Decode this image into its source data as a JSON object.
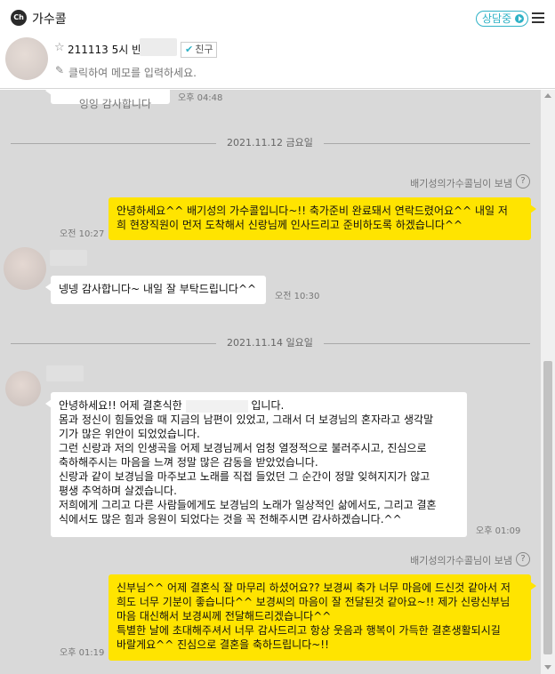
{
  "header": {
    "logo_text": "Ch",
    "title": "가수콜",
    "status_label": "상담중",
    "menu_icon": "hamburger-menu-icon"
  },
  "profile": {
    "name": "211113 5시 반포",
    "friend_badge": "친구",
    "memo_placeholder": "클릭하여 메모를 입력하세요."
  },
  "chat": {
    "top_partial": {
      "text": "잉잉 감사합니다",
      "time": "오후 04:48"
    },
    "dates": [
      "2021.11.12 금요일",
      "2021.11.14 일요일"
    ],
    "sender_label": "배기성의가수콜님이 보냄",
    "help_label": "?",
    "messages": [
      {
        "text": "안녕하세요^^ 배기성의 가수콜입니다~!! 축가준비 완료돼서 연락드렸어요^^ 내일 저\n희 현장직원이 먼저 도착해서 신랑님께 인사드리고 준비하도록 하겠습니다^^",
        "time": "오전 10:27"
      },
      {
        "text": "넹넹 감사합니다~ 내일 잘 부탁드립니다^^",
        "time": "오전 10:30"
      },
      {
        "text_a": "안녕하세요!! 어제 결혼식한",
        "text_b": "입니다.",
        "text_rest": "몸과 정신이 힘들었을 때 지금의 남편이 있었고, 그래서 더 보경님의 혼자라고 생각말\n기가 많은 위안이 되었었습니다.\n그런 신랑과 저의 인생곡을 어제 보경님께서 엄청 열정적으로 불러주시고, 진심으로\n축하해주시는 마음을 느껴 정말 많은 감동을 받았었습니다.\n신랑과 같이 보경님을 마주보고 노래를 직접 들었던 그 순간이 정말 잊혀지지가 않고\n평생 추억하며 살겠습니다.\n저희에게 그리고 다른 사람들에게도 보경님의 노래가 일상적인 삶에서도, 그리고 결혼\n식에서도 많은 힘과 응원이 되었다는 것을 꼭 전해주시면 감사하겠습니다.^^",
        "time": "오후 01:09"
      },
      {
        "text": "신부님^^ 어제 결혼식 잘 마무리 하셨어요?? 보경씨 축가 너무 마음에 드신것 같아서 저\n희도 너무 기분이 좋습니다^^ 보경씨의 마음이 잘 전달된것 같아요~!! 제가 신랑신부님\n마음 대신해서 보경씨께 전달해드리겠습니다^^\n특별한 날에 초대해주셔서 너무 감사드리고 항상 웃음과 행복이 가득한 결혼생활되시길\n바랄게요^^ 진심으로 결혼을 축하드립니다~!!",
        "time": "오후 01:19"
      }
    ]
  },
  "colors": {
    "accent": "#2fb2c6",
    "chat_bg": "#d9d9d9",
    "outgoing_bubble": "#ffe400",
    "incoming_bubble": "#ffffff"
  }
}
